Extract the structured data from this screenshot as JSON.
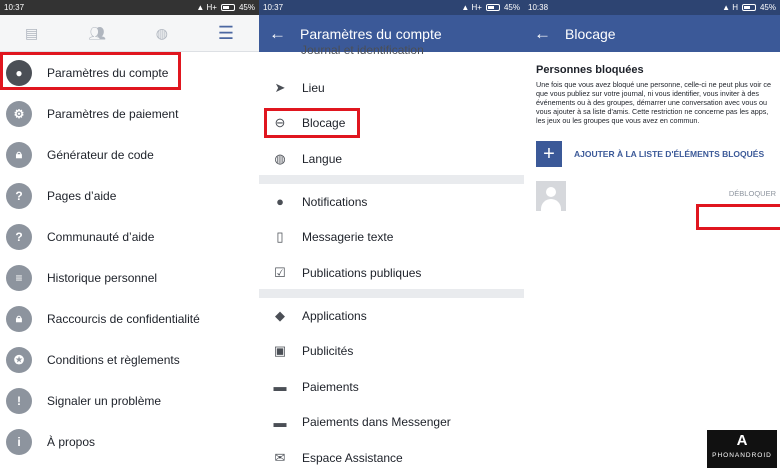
{
  "panel1": {
    "status": {
      "time": "10:37",
      "battery": "45%"
    },
    "menu": [
      {
        "label": "Paramètres du compte",
        "icon": "user-gear-icon",
        "glyph": "●"
      },
      {
        "label": "Paramètres de paiement",
        "icon": "gear-icon",
        "glyph": "⚙"
      },
      {
        "label": "Générateur de code",
        "icon": "lock-icon",
        "glyph": "🔒︎"
      },
      {
        "label": "Pages d’aide",
        "icon": "question-icon",
        "glyph": "?"
      },
      {
        "label": "Communauté d’aide",
        "icon": "question-icon",
        "glyph": "?"
      },
      {
        "label": "Historique personnel",
        "icon": "list-icon",
        "glyph": "≡"
      },
      {
        "label": "Raccourcis de confidentialité",
        "icon": "lock-icon",
        "glyph": "🔒︎"
      },
      {
        "label": "Conditions et règlements",
        "icon": "badge-icon",
        "glyph": "✪"
      },
      {
        "label": "Signaler un problème",
        "icon": "warning-icon",
        "glyph": "!"
      },
      {
        "label": "À propos",
        "icon": "info-icon",
        "glyph": "i"
      }
    ]
  },
  "panel2": {
    "status": {
      "time": "10:37",
      "battery": "45%"
    },
    "title": "Paramètres du compte",
    "partial": "Journal et identification",
    "group1": [
      {
        "label": "Lieu",
        "icon": "location-arrow-icon",
        "glyph": "➤"
      },
      {
        "label": "Blocage",
        "icon": "block-icon",
        "glyph": "⊖"
      },
      {
        "label": "Langue",
        "icon": "globe-icon",
        "glyph": "◍"
      }
    ],
    "group2": [
      {
        "label": "Notifications",
        "icon": "globe-icon",
        "glyph": "●"
      },
      {
        "label": "Messagerie texte",
        "icon": "phone-icon",
        "glyph": "▯"
      },
      {
        "label": "Publications publiques",
        "icon": "checkbox-icon",
        "glyph": "☑"
      }
    ],
    "group3": [
      {
        "label": "Applications",
        "icon": "cube-icon",
        "glyph": "◆"
      },
      {
        "label": "Publicités",
        "icon": "ad-icon",
        "glyph": "▣"
      },
      {
        "label": "Paiements",
        "icon": "card-icon",
        "glyph": "▬"
      },
      {
        "label": "Paiements dans Messenger",
        "icon": "card-icon",
        "glyph": "▬"
      },
      {
        "label": "Espace Assistance",
        "icon": "mail-icon",
        "glyph": "✉"
      }
    ]
  },
  "panel3": {
    "status": {
      "time": "10:38",
      "battery": "45%"
    },
    "title": "Blocage",
    "heading": "Personnes bloquées",
    "description": "Une fois que vous avez bloqué une personne, celle-ci ne peut plus voir ce que vous publiez sur votre journal, ni vous identifier, vous inviter à des événements ou à des groupes, démarrer une conversation avec vous ou vous ajouter à sa liste d'amis. Cette restriction ne concerne pas les apps, les jeux ou les groupes que vous avez en commun.",
    "add_label": "AJOUTER À LA LISTE D'ÉLÉMENTS BLOQUÉS",
    "unblock_label": "DÉBLOQUER",
    "logo_glyph": "A",
    "logo_text": "PHONANDROID"
  },
  "colors": {
    "brand": "#3b5998",
    "highlight": "#e0161f"
  }
}
